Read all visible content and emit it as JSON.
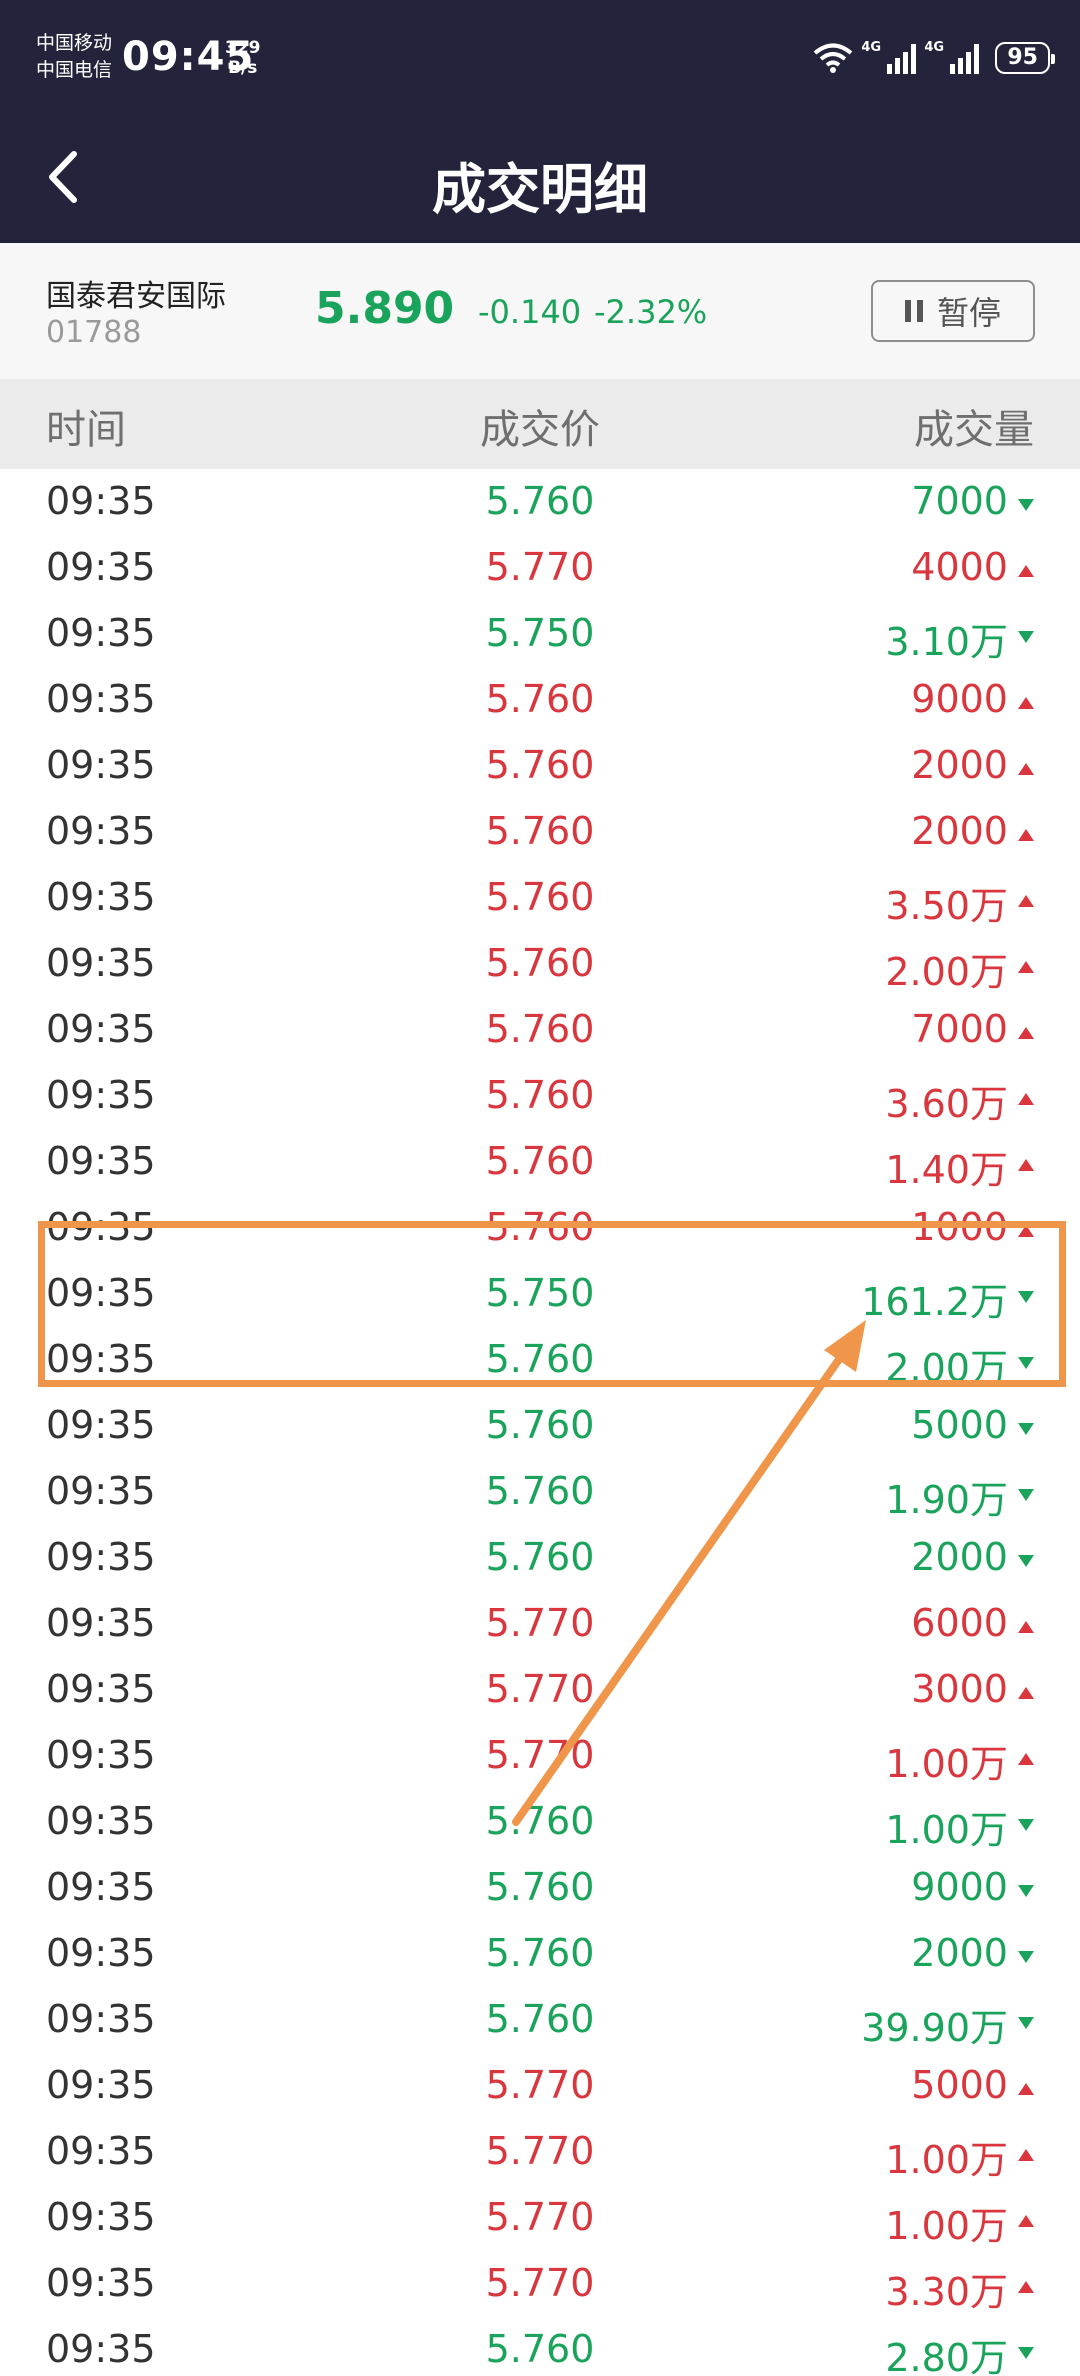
{
  "status_bar": {
    "carrier_1": "中国移动",
    "carrier_2": "中国电信",
    "time": "09:45",
    "net_speed_value": "329",
    "net_speed_unit": "B/s",
    "signal_1": "4G",
    "signal_2": "4G",
    "battery": "95"
  },
  "header": {
    "title": "成交明细",
    "back_icon": "chevron-left-icon"
  },
  "stock": {
    "name": "国泰君安国际",
    "code": "01788",
    "price": "5.890",
    "change": "-0.140",
    "change_pct": "-2.32%",
    "pause_label": "暂停"
  },
  "columns": {
    "time": "时间",
    "price": "成交价",
    "volume": "成交量"
  },
  "colors": {
    "up": "#d9363e",
    "down": "#1aa35a",
    "highlight": "#f0964a",
    "topbar": "#23243b"
  },
  "trades": [
    {
      "time": "09:35",
      "price": "5.760",
      "volume": "7000",
      "dir": "down"
    },
    {
      "time": "09:35",
      "price": "5.770",
      "volume": "4000",
      "dir": "up"
    },
    {
      "time": "09:35",
      "price": "5.750",
      "volume": "3.10万",
      "dir": "down"
    },
    {
      "time": "09:35",
      "price": "5.760",
      "volume": "9000",
      "dir": "up"
    },
    {
      "time": "09:35",
      "price": "5.760",
      "volume": "2000",
      "dir": "up"
    },
    {
      "time": "09:35",
      "price": "5.760",
      "volume": "2000",
      "dir": "up"
    },
    {
      "time": "09:35",
      "price": "5.760",
      "volume": "3.50万",
      "dir": "up"
    },
    {
      "time": "09:35",
      "price": "5.760",
      "volume": "2.00万",
      "dir": "up"
    },
    {
      "time": "09:35",
      "price": "5.760",
      "volume": "7000",
      "dir": "up"
    },
    {
      "time": "09:35",
      "price": "5.760",
      "volume": "3.60万",
      "dir": "up"
    },
    {
      "time": "09:35",
      "price": "5.760",
      "volume": "1.40万",
      "dir": "up"
    },
    {
      "time": "09:35",
      "price": "5.760",
      "volume": "1000",
      "dir": "up"
    },
    {
      "time": "09:35",
      "price": "5.750",
      "volume": "161.2万",
      "dir": "down"
    },
    {
      "time": "09:35",
      "price": "5.760",
      "volume": "2.00万",
      "dir": "down"
    },
    {
      "time": "09:35",
      "price": "5.760",
      "volume": "5000",
      "dir": "down"
    },
    {
      "time": "09:35",
      "price": "5.760",
      "volume": "1.90万",
      "dir": "down"
    },
    {
      "time": "09:35",
      "price": "5.760",
      "volume": "2000",
      "dir": "down"
    },
    {
      "time": "09:35",
      "price": "5.770",
      "volume": "6000",
      "dir": "up"
    },
    {
      "time": "09:35",
      "price": "5.770",
      "volume": "3000",
      "dir": "up"
    },
    {
      "time": "09:35",
      "price": "5.770",
      "volume": "1.00万",
      "dir": "up"
    },
    {
      "time": "09:35",
      "price": "5.760",
      "volume": "1.00万",
      "dir": "down"
    },
    {
      "time": "09:35",
      "price": "5.760",
      "volume": "9000",
      "dir": "down"
    },
    {
      "time": "09:35",
      "price": "5.760",
      "volume": "2000",
      "dir": "down"
    },
    {
      "time": "09:35",
      "price": "5.760",
      "volume": "39.90万",
      "dir": "down"
    },
    {
      "time": "09:35",
      "price": "5.770",
      "volume": "5000",
      "dir": "up"
    },
    {
      "time": "09:35",
      "price": "5.770",
      "volume": "1.00万",
      "dir": "up"
    },
    {
      "time": "09:35",
      "price": "5.770",
      "volume": "1.00万",
      "dir": "up"
    },
    {
      "time": "09:35",
      "price": "5.770",
      "volume": "3.30万",
      "dir": "up"
    },
    {
      "time": "09:35",
      "price": "5.760",
      "volume": "2.80万",
      "dir": "down"
    }
  ]
}
